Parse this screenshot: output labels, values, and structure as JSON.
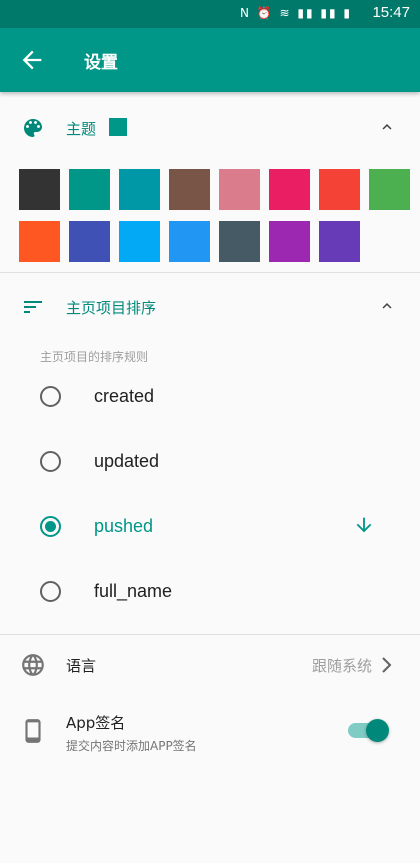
{
  "status_bar": {
    "icons": "N ⏰ ≋ ▮▮ ▮▮ ▮",
    "time": "15:47"
  },
  "app_bar": {
    "back_icon": "arrow-left-icon",
    "title": "设置"
  },
  "theme_section": {
    "label": "主题",
    "current_color": "#009688",
    "expanded": true,
    "swatches": [
      "#333333",
      "#009688",
      "#0097a7",
      "#795548",
      "#db7c8c",
      "#e91e63",
      "#f44336",
      "#4caf50",
      "#ff5722",
      "#3f51b5",
      "#03a9f4",
      "#2196f3",
      "#455a64",
      "#9c27b0",
      "#673ab7"
    ]
  },
  "sort_section": {
    "label": "主页项目排序",
    "subtitle": "主页项目的排序规则",
    "expanded": true,
    "options": [
      {
        "label": "created",
        "selected": false
      },
      {
        "label": "updated",
        "selected": false
      },
      {
        "label": "pushed",
        "selected": true
      },
      {
        "label": "full_name",
        "selected": false
      }
    ],
    "direction_icon": "arrow-down-icon"
  },
  "language": {
    "label": "语言",
    "value": "跟随系统"
  },
  "app_signature": {
    "label": "App签名",
    "description": "提交内容时添加APP签名",
    "enabled": true
  },
  "colors": {
    "primary": "#009688",
    "primary_dark": "#00796b"
  }
}
